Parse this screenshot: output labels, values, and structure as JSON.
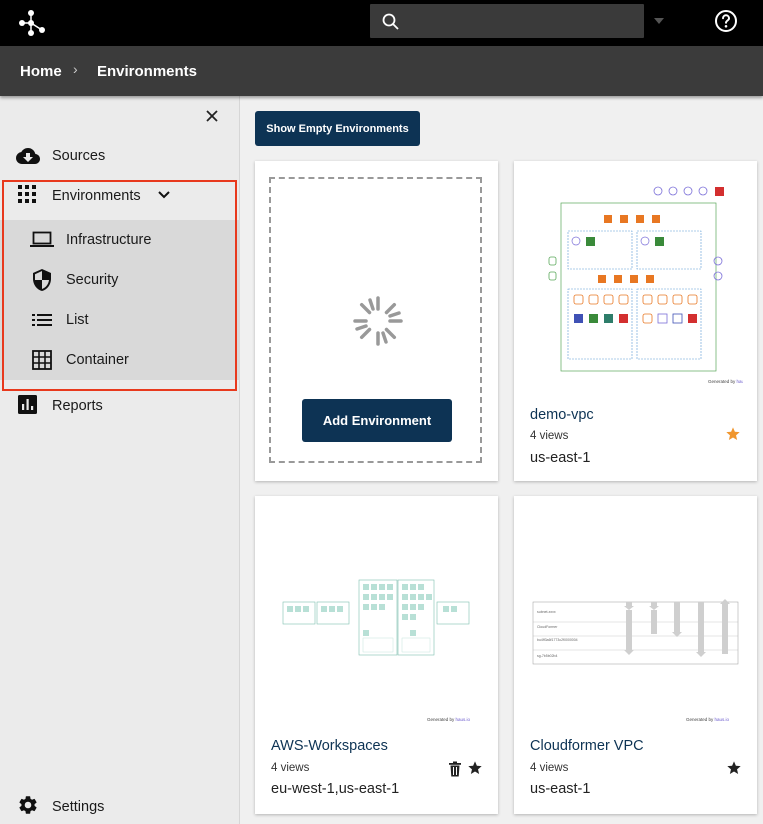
{
  "topbar": {
    "search": {
      "value": "",
      "placeholder": ""
    },
    "icons": [
      "haus-logo-icon",
      "search-icon",
      "chevron-down-icon",
      "help-icon"
    ]
  },
  "breadcrumb": {
    "home": "Home",
    "separator": "›",
    "current": "Environments"
  },
  "sidebar": {
    "items": [
      {
        "label": "Sources",
        "icon": "cloud-download-icon"
      },
      {
        "label": "Environments",
        "icon": "grid-icon"
      },
      {
        "label": "Infrastructure",
        "icon": "laptop-icon"
      },
      {
        "label": "Security",
        "icon": "shield-icon"
      },
      {
        "label": "List",
        "icon": "list-icon"
      },
      {
        "label": "Container",
        "icon": "table-grid-icon"
      },
      {
        "label": "Reports",
        "icon": "bar-chart-icon"
      },
      {
        "label": "Settings",
        "icon": "gear-icon"
      }
    ]
  },
  "main": {
    "show_empty_label": "Show Empty Environments",
    "add_environment_label": "Add Environment",
    "generated_by": "Generated by",
    "generated_by_brand": "haus.io",
    "cards": [
      {
        "name": "demo-vpc",
        "views": "4 views",
        "region": "us-east-1",
        "starred": true
      },
      {
        "name": "AWS-Workspaces",
        "views": "4 views",
        "region": "eu-west-1,us-east-1",
        "starred": false
      },
      {
        "name": "Cloudformer VPC",
        "views": "4 views",
        "region": "us-east-1",
        "starred": false
      }
    ]
  },
  "colors": {
    "topbar": "#000000",
    "breadcrumb_bar": "#3b3b3b",
    "primary_button": "#0d3354",
    "highlight_border": "#e8391d",
    "star_active": "#f0962e",
    "link": "#0d3354"
  }
}
